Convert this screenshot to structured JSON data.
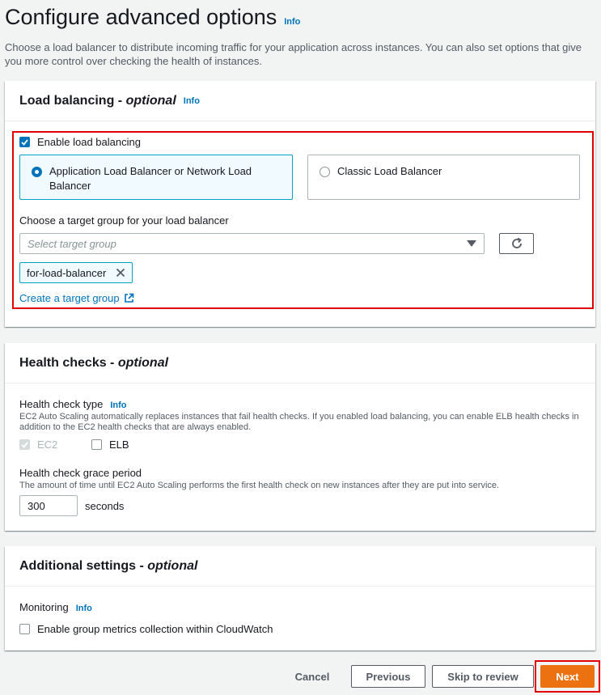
{
  "page": {
    "title": "Configure advanced options",
    "info": "Info",
    "description": "Choose a load balancer to distribute incoming traffic for your application across instances. You can also set options that give you more control over checking the health of instances."
  },
  "load_balancing": {
    "title": "Load balancing",
    "title_suffix": "optional",
    "info": "Info",
    "enable_label": "Enable load balancing",
    "enable_checked": true,
    "options": [
      {
        "label": "Application Load Balancer or Network Load Balancer",
        "selected": true
      },
      {
        "label": "Classic Load Balancer",
        "selected": false
      }
    ],
    "target_group_label": "Choose a target group for your load balancer",
    "target_group_placeholder": "Select target group",
    "selected_token": "for-load-balancer",
    "create_link": "Create a target group"
  },
  "health_checks": {
    "title": "Health checks",
    "title_suffix": "optional",
    "type_label": "Health check type",
    "info": "Info",
    "type_description": "EC2 Auto Scaling automatically replaces instances that fail health checks. If you enabled load balancing, you can enable ELB health checks in addition to the EC2 health checks that are always enabled.",
    "ec2_label": "EC2",
    "elb_label": "ELB",
    "grace_label": "Health check grace period",
    "grace_description": "The amount of time until EC2 Auto Scaling performs the first health check on new instances after they are put into service.",
    "grace_value": "300",
    "grace_unit": "seconds"
  },
  "additional": {
    "title": "Additional settings",
    "title_suffix": "optional",
    "monitoring_label": "Monitoring",
    "info": "Info",
    "metrics_label": "Enable group metrics collection within CloudWatch"
  },
  "footer": {
    "cancel": "Cancel",
    "previous": "Previous",
    "skip": "Skip to review",
    "next": "Next"
  },
  "colors": {
    "accent": "#0073bb",
    "primary_button": "#ec7211",
    "highlight": "#e30000"
  }
}
